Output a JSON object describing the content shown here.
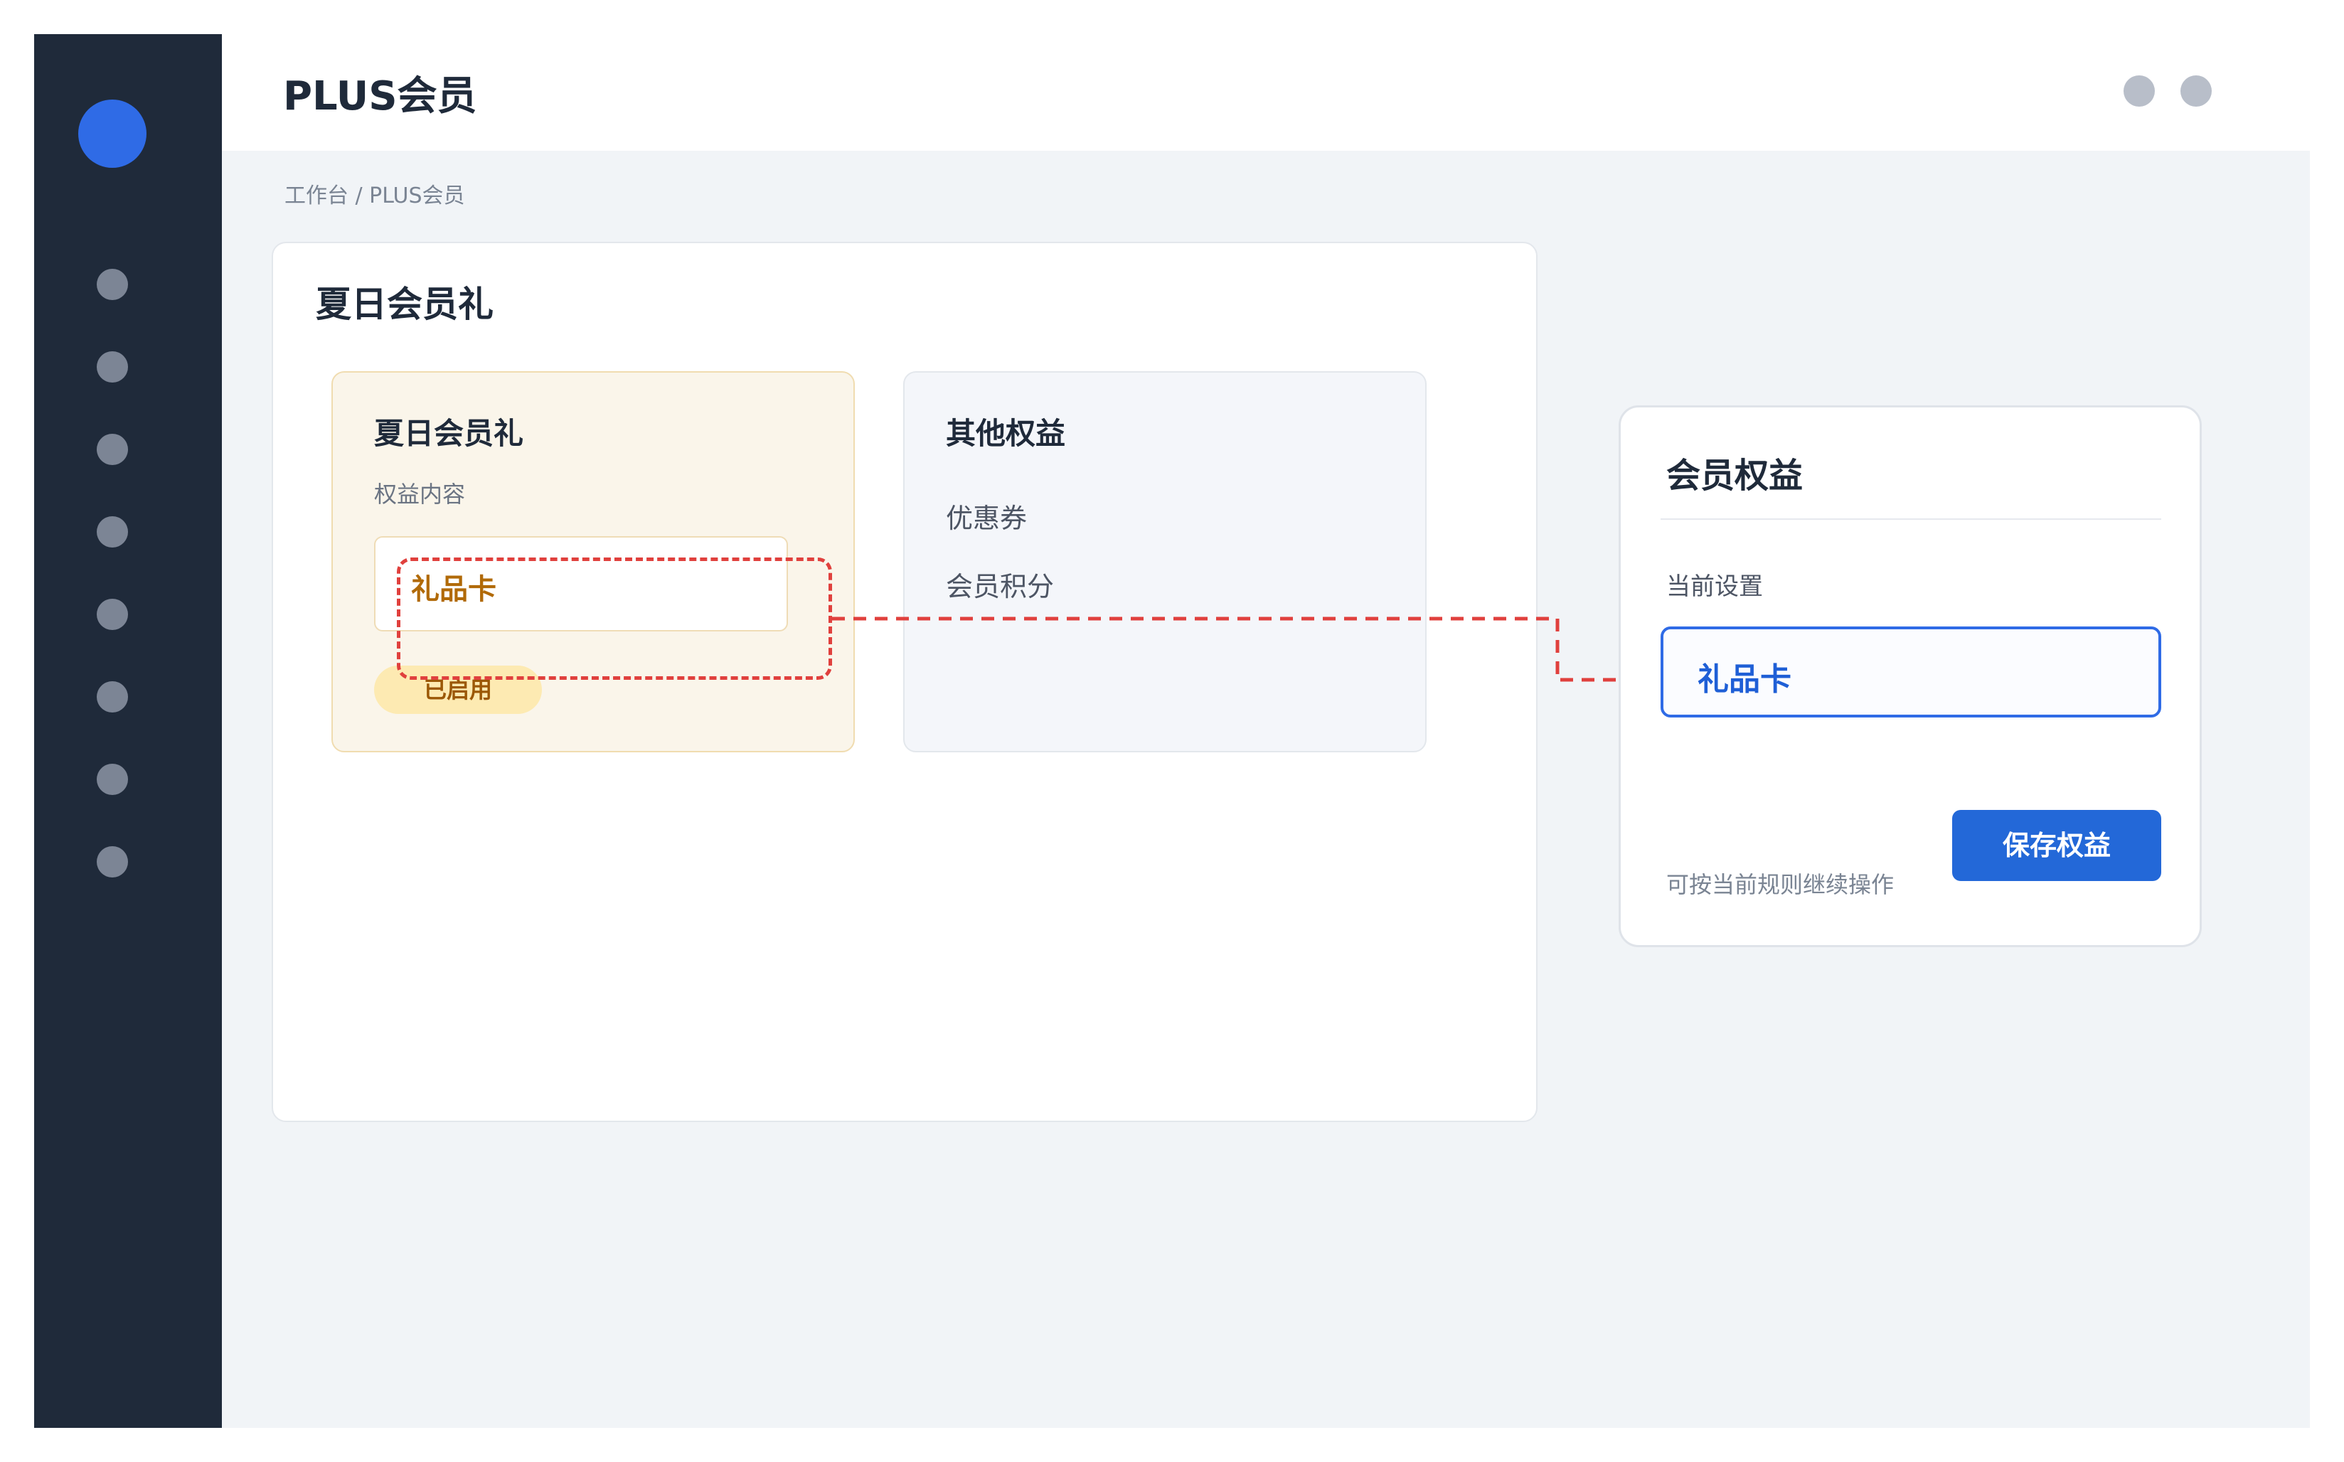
{
  "header": {
    "title": "PLUS会员"
  },
  "breadcrumb": "工作台 / PLUS会员",
  "main_card": {
    "title": "夏日会员礼",
    "summer_card": {
      "title": "夏日会员礼",
      "label": "权益内容",
      "value": "礼品卡",
      "status": "已启用"
    },
    "other_card": {
      "title": "其他权益",
      "items": [
        "优惠券",
        "会员积分"
      ]
    }
  },
  "side_panel": {
    "title": "会员权益",
    "label": "当前设置",
    "value": "礼品卡",
    "hint": "可按当前规则继续操作",
    "save_label": "保存权益"
  },
  "colors": {
    "sidebar": "#1f2a3a",
    "accent": "#2f6be6",
    "primary_button": "#2368d8",
    "highlight": "#e0403d",
    "gift_text": "#b16a08",
    "badge_bg": "#fdeab2"
  },
  "icons": {
    "sidebar_logo": "logo-circle-icon",
    "sidebar_nav": "nav-dot-icon",
    "topbar": "user-dot-icon"
  }
}
